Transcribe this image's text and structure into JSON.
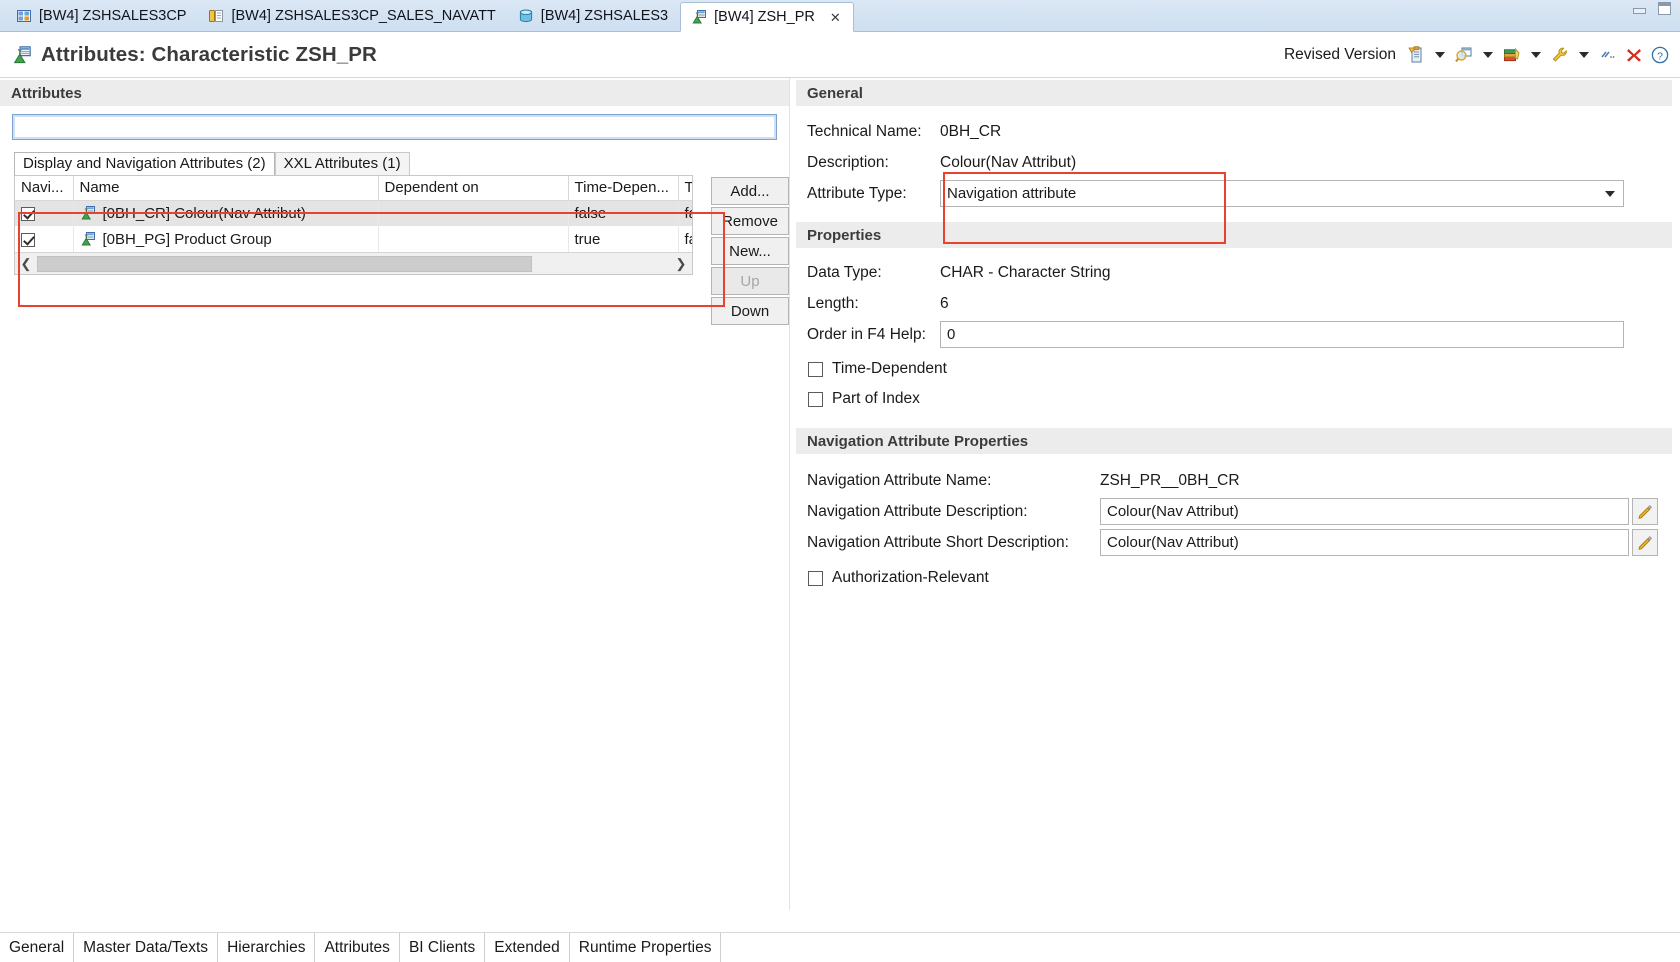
{
  "window": {
    "minimize_label": "minimize",
    "maximize_label": "maximize"
  },
  "editor_tabs": [
    {
      "label": "[BW4] ZSHSALES3CP",
      "icon": "cube-grid-icon",
      "active": false,
      "closable": false
    },
    {
      "label": "[BW4] ZSHSALES3CP_SALES_NAVATT",
      "icon": "composite-provider-icon",
      "active": false,
      "closable": false
    },
    {
      "label": "[BW4] ZSHSALES3",
      "icon": "datastore-object-icon",
      "active": false,
      "closable": false
    },
    {
      "label": "[BW4] ZSH_PR",
      "icon": "characteristic-icon",
      "active": true,
      "closable": true,
      "close_glyph": "✕"
    }
  ],
  "header": {
    "title": "Attributes: Characteristic ZSH_PR",
    "title_icon": "characteristic-icon",
    "version_label": "Revised Version",
    "toolbar_icons": [
      {
        "name": "clipboard-version-icon",
        "has_caret": true
      },
      {
        "name": "where-used-search-icon",
        "has_caret": true
      },
      {
        "name": "documentation-books-icon",
        "has_caret": true
      },
      {
        "name": "wrench-tools-icon",
        "has_caret": true
      },
      {
        "name": "collapse-all-icon",
        "has_caret": false
      },
      {
        "name": "delete-red-x-icon",
        "has_caret": false
      },
      {
        "name": "help-question-icon",
        "has_caret": false
      }
    ]
  },
  "left_panel": {
    "section_title": "Attributes",
    "filter": {
      "value": "",
      "placeholder": ""
    },
    "tabs": [
      {
        "label": "Display and Navigation Attributes (2)",
        "active": true
      },
      {
        "label": "XXL Attributes (1)",
        "active": false
      }
    ],
    "table": {
      "columns": [
        "Navi...",
        "Name",
        "Dependent on",
        "Time-Depen...",
        "Trans"
      ],
      "rows": [
        {
          "navigational": true,
          "icon": "characteristic-icon",
          "name": "[0BH_CR] Colour(Nav Attribut)",
          "dependent_on": "",
          "time_dependent": "false",
          "transitive": "false",
          "selected": true
        },
        {
          "navigational": true,
          "icon": "characteristic-icon",
          "name": "[0BH_PG] Product Group",
          "dependent_on": "",
          "time_dependent": "true",
          "transitive": "false",
          "selected": false
        }
      ]
    },
    "scrollbar": {
      "left_arrow": "❮",
      "right_arrow": "❯"
    },
    "buttons": [
      {
        "label": "Add...",
        "enabled": true
      },
      {
        "label": "Remove",
        "enabled": true
      },
      {
        "label": "New...",
        "enabled": true
      },
      {
        "label": "Up",
        "enabled": false
      },
      {
        "label": "Down",
        "enabled": true
      }
    ]
  },
  "right_panel": {
    "general": {
      "section_title": "General",
      "technical_name_label": "Technical Name:",
      "technical_name_value": "0BH_CR",
      "description_label": "Description:",
      "description_value": "Colour(Nav Attribut)",
      "attribute_type_label": "Attribute Type:",
      "attribute_type_value": "Navigation attribute"
    },
    "properties": {
      "section_title": "Properties",
      "data_type_label": "Data Type:",
      "data_type_value": "CHAR - Character String",
      "length_label": "Length:",
      "length_value": "6",
      "order_f4_label": "Order in F4 Help:",
      "order_f4_value": "0",
      "time_dependent_label": "Time-Dependent",
      "time_dependent_checked": false,
      "part_of_index_label": "Part of Index",
      "part_of_index_checked": false
    },
    "nav_attribute_properties": {
      "section_title": "Navigation Attribute Properties",
      "name_label": "Navigation Attribute Name:",
      "name_value": "ZSH_PR__0BH_CR",
      "description_label": "Navigation Attribute Description:",
      "description_value": "Colour(Nav Attribut)",
      "short_description_label": "Navigation Attribute Short Description:",
      "short_description_value": "Colour(Nav Attribut)",
      "authorization_relevant_label": "Authorization-Relevant",
      "authorization_relevant_checked": false
    }
  },
  "bottom_tabs": [
    {
      "label": "General",
      "active": false
    },
    {
      "label": "Master Data/Texts",
      "active": false
    },
    {
      "label": "Hierarchies",
      "active": false
    },
    {
      "label": "Attributes",
      "active": true
    },
    {
      "label": "BI Clients",
      "active": false
    },
    {
      "label": "Extended",
      "active": false
    },
    {
      "label": "Runtime Properties",
      "active": false
    }
  ],
  "annotations": {
    "highlight_color": "#e8412c",
    "boxes": [
      {
        "name": "attribute-type-highlight"
      },
      {
        "name": "attribute-list-highlight"
      }
    ]
  }
}
